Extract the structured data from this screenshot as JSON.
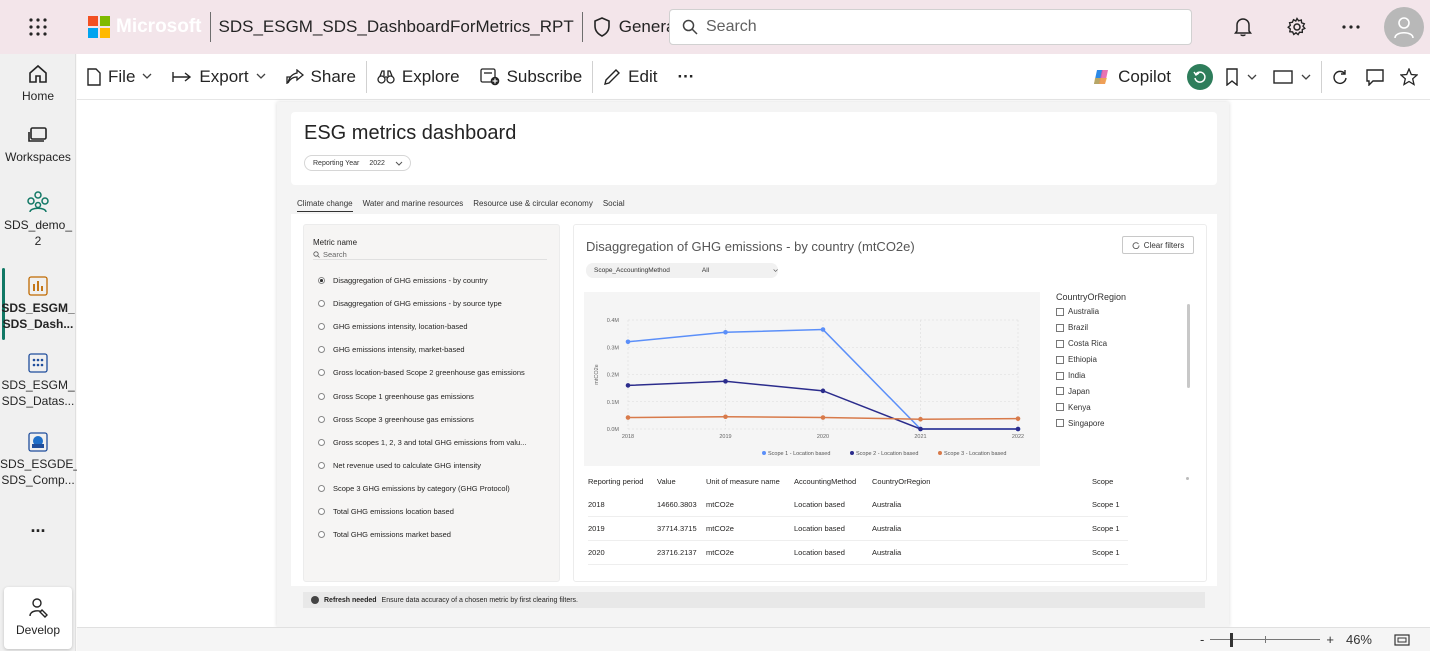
{
  "topbar": {
    "brand": "Microsoft",
    "report_name": "SDS_ESGM_SDS_DashboardForMetrics_RPT",
    "sensitivity": "General",
    "search_placeholder": "Search",
    "icons": [
      "app-launcher-icon",
      "bell-icon",
      "gear-icon",
      "more-icon",
      "avatar-icon"
    ],
    "ms_colors": [
      "#f25022",
      "#7fba00",
      "#00a4ef",
      "#ffb900"
    ]
  },
  "leftnav": {
    "items": [
      {
        "label": "Home",
        "icon": "home-icon"
      },
      {
        "label": "Workspaces",
        "icon": "workspaces-icon"
      },
      {
        "label": "SDS_demo_\n2",
        "line1": "SDS_demo_",
        "line2": "2",
        "icon": "workspace-group-icon"
      },
      {
        "line1": "SDS_ESGM_",
        "line2": "SDS_Dash...",
        "icon": "report-icon"
      },
      {
        "line1": "SDS_ESGM_",
        "line2": "SDS_Datas...",
        "icon": "dataset-icon"
      },
      {
        "line1": "SDS_ESGDE_",
        "line2": "SDS_Comp...",
        "icon": "composite-icon"
      }
    ],
    "more": "...",
    "develop": "Develop",
    "accent": "#117865"
  },
  "toolbar": {
    "file": "File",
    "export": "Export",
    "share": "Share",
    "explore": "Explore",
    "subscribe": "Subscribe",
    "edit": "Edit",
    "more": "···",
    "copilot": "Copilot"
  },
  "report": {
    "title": "ESG metrics dashboard",
    "year_label": "Reporting Year",
    "year_value": "2022",
    "tabs": [
      "Climate change",
      "Water and marine resources",
      "Resource use & circular economy",
      "Social"
    ],
    "metric_panel": {
      "title": "Metric name",
      "search": "Search",
      "items": [
        "Disaggregation of GHG emissions - by country",
        "Disaggregation of GHG emissions - by source type",
        "GHG emissions intensity, location-based",
        "GHG emissions intensity, market-based",
        "Gross location-based Scope 2 greenhouse gas emissions",
        "Gross Scope 1 greenhouse gas emissions",
        "Gross Scope 3 greenhouse gas emissions",
        "Gross scopes 1, 2, 3 and total GHG emissions from valu...",
        "Net revenue used to calculate GHG intensity",
        "Scope 3 GHG emissions by category (GHG Protocol)",
        "Total GHG emissions location based",
        "Total GHG emissions market based"
      ],
      "selected_index": 0
    },
    "chart_title": "Disaggregation of GHG emissions - by country (mtCO2e)",
    "clear_filters": "Clear filters",
    "scope_slicer_label": "Scope_AccountingMethod",
    "scope_slicer_value": "All",
    "legend": {
      "title": "CountryOrRegion",
      "items": [
        "Australia",
        "Brazil",
        "Costa Rica",
        "Ethiopia",
        "India",
        "Japan",
        "Kenya",
        "Singapore"
      ]
    },
    "table": {
      "headers": [
        "Reporting period",
        "Value",
        "Unit of measure name",
        "AccountingMethod",
        "CountryOrRegion",
        "Scope"
      ],
      "rows": [
        [
          "2018",
          "14660.3803",
          "mtCO2e",
          "Location based",
          "Australia",
          "Scope 1"
        ],
        [
          "2019",
          "37714.3715",
          "mtCO2e",
          "Location based",
          "Australia",
          "Scope 1"
        ],
        [
          "2020",
          "23716.2137",
          "mtCO2e",
          "Location based",
          "Australia",
          "Scope 1"
        ]
      ]
    },
    "refresh_label": "Refresh needed",
    "refresh_text": "Ensure data accuracy of a chosen metric by first clearing filters."
  },
  "chart_data": {
    "type": "line",
    "x": [
      "2018",
      "2019",
      "2020",
      "2021",
      "2022"
    ],
    "ylabel": "mtCO2e",
    "ylim": [
      0,
      0.4
    ],
    "y_ticks": [
      "0.0M",
      "0.1M",
      "0.2M",
      "0.3M",
      "0.4M"
    ],
    "series": [
      {
        "name": "Scope 1 - Location based",
        "color": "#5b8ff9",
        "values": [
          0.32,
          0.355,
          0.365,
          0.0,
          0.0
        ]
      },
      {
        "name": "Scope 2 - Location based",
        "color": "#2b2c8c",
        "values": [
          0.16,
          0.175,
          0.14,
          0.0,
          0.0
        ]
      },
      {
        "name": "Scope 3 - Location based",
        "color": "#d87a4a",
        "values": [
          0.042,
          0.045,
          0.042,
          0.036,
          0.038
        ]
      }
    ],
    "grid": true,
    "legend_position": "bottom"
  },
  "statusbar": {
    "minus": "-",
    "plus": "+",
    "zoom": "46%"
  }
}
